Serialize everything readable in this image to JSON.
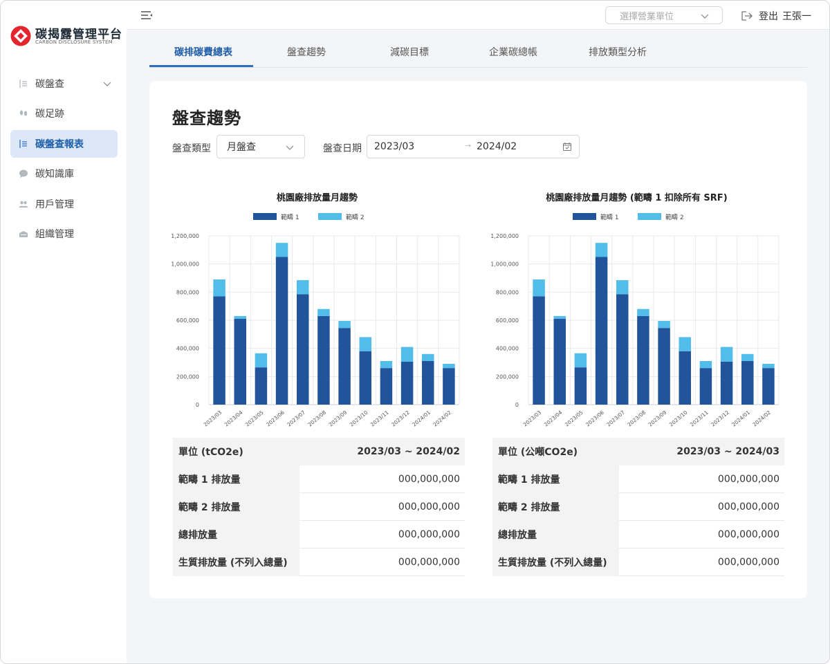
{
  "app": {
    "name": "碳揭露管理平台",
    "subtitle": "CARBON DISCLOSURE SYSTEM",
    "brand_color": "#e3262d"
  },
  "sidebar": {
    "items": [
      {
        "label": "碳盤查",
        "icon": "list-icon",
        "active": false,
        "has_submenu": true
      },
      {
        "label": "碳足跡",
        "icon": "footprint-icon",
        "active": false
      },
      {
        "label": "碳盤查報表",
        "icon": "list-icon",
        "active": true
      },
      {
        "label": "碳知識庫",
        "icon": "chat-icon",
        "active": false
      },
      {
        "label": "用戶管理",
        "icon": "users-icon",
        "active": false
      },
      {
        "label": "組織管理",
        "icon": "building-icon",
        "active": false
      }
    ]
  },
  "topbar": {
    "unit_placeholder": "選擇營業單位",
    "logout_label": "登出",
    "user_name": "王張一"
  },
  "tabs": [
    {
      "label": "碳排碳費總表",
      "active": true
    },
    {
      "label": "盤查趨勢",
      "active": false
    },
    {
      "label": "減碳目標",
      "active": false
    },
    {
      "label": "企業碳總帳",
      "active": false
    },
    {
      "label": "排放類型分析",
      "active": false
    }
  ],
  "page": {
    "title": "盤查趨勢",
    "filter_type_label": "盤查類型",
    "filter_type_value": "月盤查",
    "filter_date_label": "盤查日期",
    "date_start": "2023/03",
    "date_end": "2024/02"
  },
  "colors": {
    "scope1": "#22549c",
    "scope2": "#52bde9",
    "accent": "#2f6fc0"
  },
  "chart_data": [
    {
      "type": "bar",
      "stacked": true,
      "title": "桃園廠排放量月趨勢",
      "categories": [
        "2023/03",
        "2023/04",
        "2023/05",
        "2023/06",
        "2023/07",
        "2023/08",
        "2023/09",
        "2023/10",
        "2023/11",
        "2023/12",
        "2024/01",
        "2024/02"
      ],
      "series": [
        {
          "name": "範疇 1",
          "values": [
            770000,
            610000,
            265000,
            1050000,
            785000,
            630000,
            545000,
            380000,
            260000,
            305000,
            310000,
            260000
          ]
        },
        {
          "name": "範疇 2",
          "values": [
            120000,
            20000,
            100000,
            100000,
            100000,
            50000,
            50000,
            100000,
            50000,
            105000,
            50000,
            30000
          ]
        }
      ],
      "ylim": [
        0,
        1200000
      ],
      "yticks": [
        "0",
        "200,000",
        "400,000",
        "600,000",
        "800,000",
        "1,000,000",
        "1,200,000"
      ],
      "legend": "top",
      "grid": true
    },
    {
      "type": "bar",
      "stacked": true,
      "title": "桃園廠排放量月趨勢 (範疇 1 扣除所有 SRF)",
      "categories": [
        "2023/03",
        "2023/04",
        "2023/05",
        "2023/06",
        "2023/07",
        "2023/08",
        "2023/09",
        "2023/10",
        "2023/11",
        "2023/12",
        "2024/01",
        "2024/02"
      ],
      "series": [
        {
          "name": "範疇 1",
          "values": [
            770000,
            610000,
            265000,
            1050000,
            785000,
            630000,
            545000,
            380000,
            260000,
            305000,
            310000,
            260000
          ]
        },
        {
          "name": "範疇 2",
          "values": [
            120000,
            20000,
            100000,
            100000,
            100000,
            50000,
            50000,
            100000,
            50000,
            105000,
            50000,
            30000
          ]
        }
      ],
      "ylim": [
        0,
        1200000
      ],
      "yticks": [
        "0",
        "200,000",
        "400,000",
        "600,000",
        "800,000",
        "1,000,000",
        "1,200,000"
      ],
      "legend": "top",
      "grid": true
    }
  ],
  "tables": [
    {
      "unit_label": "單位 (tCO2e)",
      "period": "2023/03 ~ 2024/02",
      "rows": [
        {
          "label": "範疇 1 排放量",
          "value": "000,000,000"
        },
        {
          "label": "範疇 2 排放量",
          "value": "000,000,000"
        },
        {
          "label": "總排放量",
          "value": "000,000,000"
        },
        {
          "label": "生質排放量 (不列入總量)",
          "value": "000,000,000"
        }
      ]
    },
    {
      "unit_label": "單位 (公噸CO2e)",
      "period": "2023/03 ~ 2024/03",
      "rows": [
        {
          "label": "範疇 1 排放量",
          "value": "000,000,000"
        },
        {
          "label": "範疇 2 排放量",
          "value": "000,000,000"
        },
        {
          "label": "總排放量",
          "value": "000,000,000"
        },
        {
          "label": "生質排放量 (不列入總量)",
          "value": "000,000,000"
        }
      ]
    }
  ]
}
